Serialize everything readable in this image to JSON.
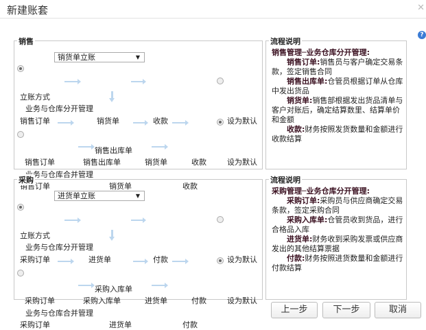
{
  "window": {
    "title": "新建账套",
    "close_icon": "close-icon",
    "help_icon": "help-icon"
  },
  "sections": [
    {
      "key": "sales",
      "legend": "销售",
      "method_label": "立账方式",
      "method_value": "销货单立账",
      "mode1": {
        "label": "业务与仓库分开管理",
        "selected": true
      },
      "row1": [
        "销售订单",
        "销货单",
        "收款"
      ],
      "row1_default": {
        "label": "设为默认",
        "selected": false
      },
      "branch_label": "销售出库单",
      "row2": [
        "销售订单",
        "销售出库单",
        "销货单",
        "收款"
      ],
      "row2_default": {
        "label": "设为默认",
        "selected": true
      },
      "mode2": {
        "label": "业务与仓库合并管理",
        "selected": false
      },
      "row3": [
        "销售订单",
        "销货单",
        "收款"
      ],
      "desc": {
        "legend": "流程说明",
        "heading": "销售管理─业务仓库分开管理:",
        "items": [
          {
            "term": "销售订单:",
            "text": "销售员与客户确定交易条款，签定销售合同"
          },
          {
            "term": "销售出库单:",
            "text": "仓管员根据订单从仓库中发出货品"
          },
          {
            "term": "销货单:",
            "text": "销售部根据发出货品清单与客户对账后，确定结算数里、结算单价和金额"
          },
          {
            "term": "收款:",
            "text": "财务按照发货数量和金额进行收款结算"
          }
        ]
      }
    },
    {
      "key": "purchase",
      "legend": "采购",
      "method_label": "立账方式",
      "method_value": "进货单立账",
      "mode1": {
        "label": "业务与仓库分开管理",
        "selected": true
      },
      "row1": [
        "采购订单",
        "进货单",
        "付款"
      ],
      "row1_default": {
        "label": "设为默认",
        "selected": false
      },
      "branch_label": "采购入库单",
      "row2": [
        "采购订单",
        "采购入库单",
        "进货单",
        "付款"
      ],
      "row2_default": {
        "label": "设为默认",
        "selected": true
      },
      "mode2": {
        "label": "业务与仓库合并管理",
        "selected": false
      },
      "row3": [
        "采购订单",
        "进货单",
        "付款"
      ],
      "desc": {
        "legend": "流程说明",
        "heading": "采购管理─业务仓库分开管理:",
        "items": [
          {
            "term": "采购订单:",
            "text": "采购员与供应商确定交易条款，签定采购合同"
          },
          {
            "term": "采购入库单:",
            "text": "仓管员收到货品，进行合格品入库"
          },
          {
            "term": "进货单:",
            "text": "财务收到采购发票或供应商发出的其他结算票据"
          },
          {
            "term": "付款:",
            "text": "财务按照进货数量和金额进行付款结算"
          }
        ]
      }
    }
  ],
  "buttons": {
    "prev": "上一步",
    "next": "下一步",
    "cancel": "取消"
  }
}
